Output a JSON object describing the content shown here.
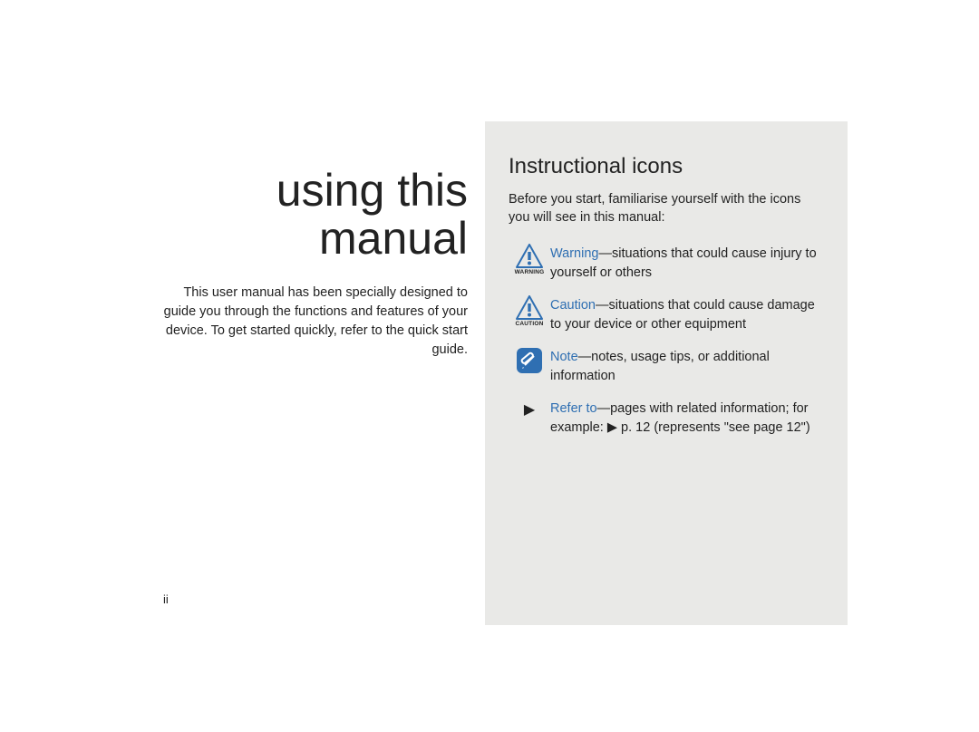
{
  "left": {
    "title_line1": "using this",
    "title_line2": "manual",
    "body": "This user manual has been specially designed to guide you through the functions and features of your device. To get started quickly, refer to the quick start guide."
  },
  "right": {
    "heading": "Instructional icons",
    "intro": "Before you start, familiarise yourself with the icons you will see in this manual:",
    "items": {
      "warning": {
        "sub": "WARNING",
        "kw": "Warning",
        "desc": "—situations that could cause injury to yourself or others"
      },
      "caution": {
        "sub": "CAUTION",
        "kw": "Caution",
        "desc": "—situations that could cause damage to your device or other equipment"
      },
      "note": {
        "kw": "Note",
        "desc": "—notes, usage tips, or additional information"
      },
      "refer": {
        "arrow": "▶",
        "kw": "Refer to",
        "desc_a": "—pages with related information; for example: ",
        "inline_arrow": "▶",
        "desc_b": " p. 12 (represents \"see page 12\")"
      }
    }
  },
  "page_number": "ii"
}
